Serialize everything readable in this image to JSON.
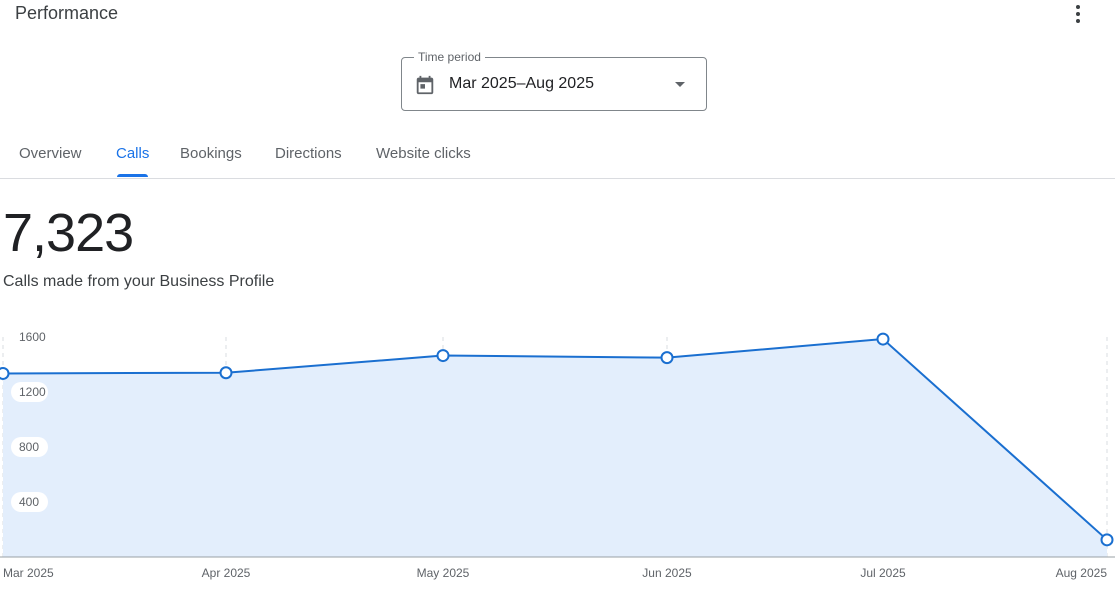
{
  "header": {
    "title": "Performance",
    "more_icon": "more-vert-icon"
  },
  "time_period": {
    "label": "Time period",
    "value": "Mar 2025–Aug 2025",
    "icon": "calendar-icon"
  },
  "tabs": [
    {
      "label": "Overview",
      "active": false
    },
    {
      "label": "Calls",
      "active": true
    },
    {
      "label": "Bookings",
      "active": false
    },
    {
      "label": "Directions",
      "active": false
    },
    {
      "label": "Website clicks",
      "active": false
    }
  ],
  "metric": {
    "value": "7,323",
    "description": "Calls made from your Business Profile"
  },
  "colors": {
    "accent": "#1a73e8",
    "line": "#1a6fd0",
    "fill": "#e3eefc"
  },
  "chart_data": {
    "type": "area",
    "x": [
      "Mar 2025",
      "Apr 2025",
      "May 2025",
      "Jun 2025",
      "Jul 2025",
      "Aug 2025"
    ],
    "series": [
      {
        "values": [
          1335,
          1340,
          1465,
          1450,
          1585,
          125
        ]
      }
    ],
    "y_ticks": [
      "1600",
      "1200",
      "800",
      "400"
    ],
    "ylim": [
      0,
      1600
    ],
    "grid": "vertical dashed"
  }
}
